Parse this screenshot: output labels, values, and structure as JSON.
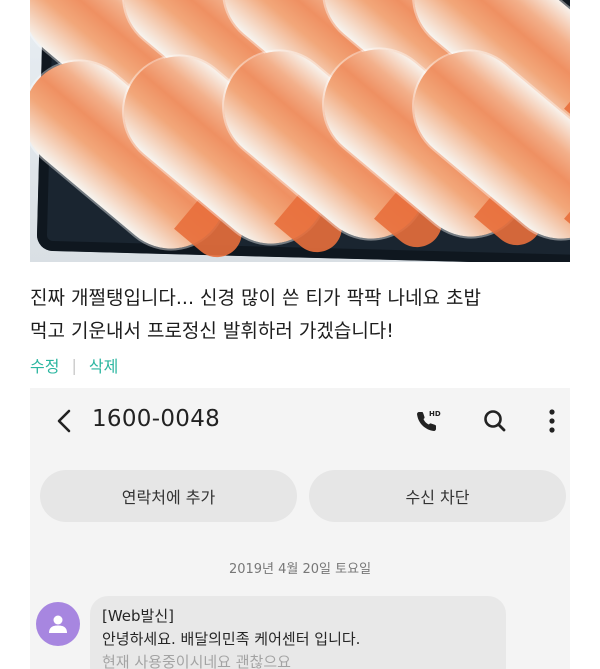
{
  "post": {
    "line1": "진짜 개쩔탱입니다... 신경 많이 쓴 티가 팍팍 나네요 초밥",
    "line2": "먹고 기운내서 프로정신 발휘하러 가겠습니다!",
    "edit_label": "수정",
    "delete_label": "삭제"
  },
  "phone": {
    "number": "1600-0048",
    "add_contact_label": "연락처에 추가",
    "block_label": "수신 차단",
    "date": "2019년 4월 20일 토요일",
    "message": {
      "line1": "[Web발신]",
      "line2": "안녕하세요. 배달의민족 케어센터 입니다.",
      "line3": "현재 사용중이시네요 괜찮으요"
    },
    "icons": [
      "back-arrow-icon",
      "hd-call-icon",
      "search-icon",
      "more-vertical-icon",
      "person-icon"
    ]
  },
  "colors": {
    "accent": "#2bb6a0",
    "avatar": "#a786e0",
    "pill": "#e6e6e6",
    "screen_bg": "#f4f4f4"
  }
}
